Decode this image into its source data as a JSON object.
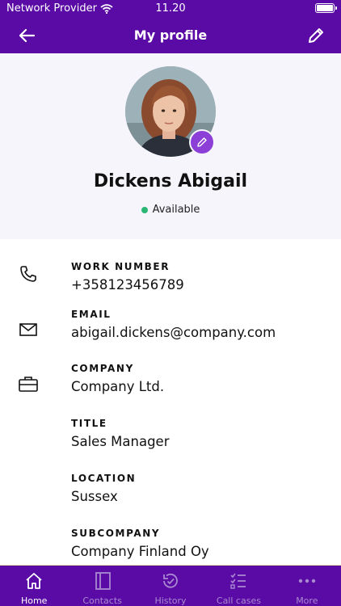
{
  "status_bar": {
    "carrier": "Network Provider",
    "time": "11.20"
  },
  "header": {
    "title": "My profile"
  },
  "profile": {
    "name": "Dickens Abigail",
    "status": "Available",
    "status_color": "#2bb673"
  },
  "fields": {
    "work_number": {
      "label": "WORK NUMBER",
      "value": "+358123456789"
    },
    "email": {
      "label": "EMAIL",
      "value": "abigail.dickens@company.com"
    },
    "company": {
      "label": "COMPANY",
      "value": "Company Ltd."
    },
    "title": {
      "label": "TITLE",
      "value": "Sales Manager"
    },
    "location": {
      "label": "LOCATION",
      "value": "Sussex"
    },
    "subcompany": {
      "label": "SUBCOMPANY",
      "value": "Company Finland Oy"
    }
  },
  "tabs": [
    {
      "label": "Home",
      "icon": "home-icon",
      "active": true
    },
    {
      "label": "Contacts",
      "icon": "contacts-book-icon",
      "active": false
    },
    {
      "label": "History",
      "icon": "history-check-icon",
      "active": false
    },
    {
      "label": "Call cases",
      "icon": "call-cases-icon",
      "active": false
    },
    {
      "label": "More",
      "icon": "more-dots-icon",
      "active": false
    }
  ],
  "colors": {
    "brand": "#5a0aa5",
    "accent": "#8b3fd6",
    "header_bg": "#f7f5fc"
  }
}
